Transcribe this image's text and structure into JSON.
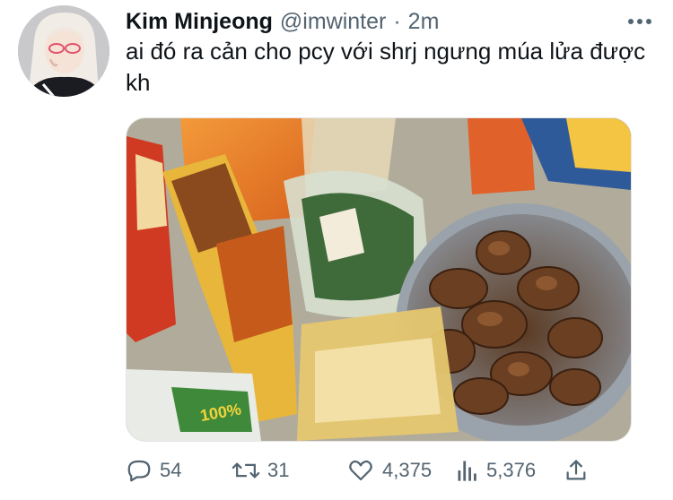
{
  "tweet": {
    "author_name": "Kim Minjeong",
    "handle": "@imwinter",
    "separator": "·",
    "time": "2m",
    "text": "ai đó ra cản cho pcy với shrj ngưng múa lửa được kh",
    "more_icon": "more-horizontal-icon"
  },
  "media": {
    "kind": "photo",
    "package_label": "100%"
  },
  "actions": {
    "replies": "54",
    "retweets": "31",
    "likes": "4,375",
    "views": "5,376",
    "icons": [
      "reply-icon",
      "retweet-icon",
      "like-icon",
      "views-icon",
      "share-icon"
    ]
  },
  "colors": {
    "text_primary": "#0f1419",
    "text_secondary": "#536471"
  }
}
